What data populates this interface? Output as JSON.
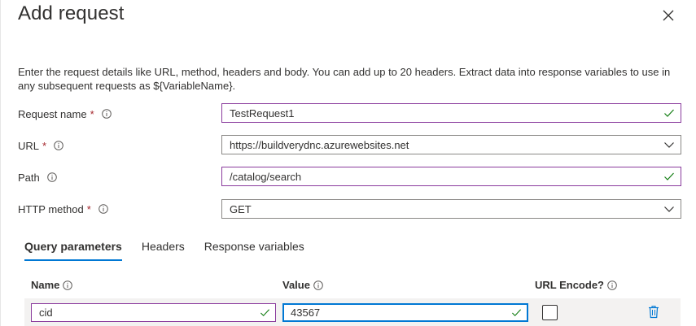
{
  "panel": {
    "title": "Add request",
    "close_icon": "close-icon",
    "description": "Enter the request details like URL, method, headers and body. You can add up to 20 headers. Extract data into response variables to use in any subsequent requests as ${VariableName}."
  },
  "form": {
    "request_name": {
      "label": "Request name",
      "required": "*",
      "value": "TestRequest1"
    },
    "url": {
      "label": "URL",
      "required": "*",
      "value": "https://buildverydnc.azurewebsites.net"
    },
    "path": {
      "label": "Path",
      "value": "/catalog/search"
    },
    "http_method": {
      "label": "HTTP method",
      "required": "*",
      "value": "GET"
    }
  },
  "tabs": [
    {
      "label": "Query parameters",
      "active": true
    },
    {
      "label": "Headers",
      "active": false
    },
    {
      "label": "Response variables",
      "active": false
    }
  ],
  "query_table": {
    "columns": {
      "name": "Name",
      "value": "Value",
      "url_encode": "URL Encode?"
    },
    "rows": [
      {
        "name": "cid",
        "value": "43567",
        "url_encode": false
      }
    ]
  },
  "colors": {
    "accent": "#0078d4",
    "valid_border": "#8a3b9d",
    "valid_check": "#107c10",
    "required": "#a4262c"
  }
}
